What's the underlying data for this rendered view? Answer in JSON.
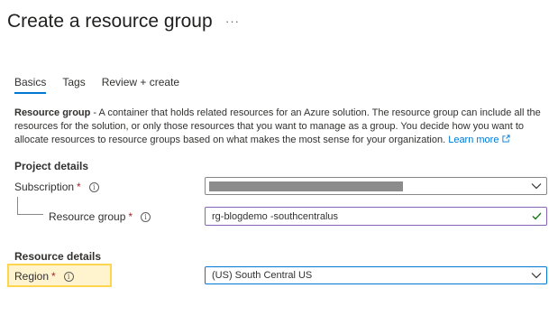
{
  "header": {
    "title": "Create a resource group",
    "more_label": "···"
  },
  "tabs": [
    {
      "label": "Basics",
      "active": true
    },
    {
      "label": "Tags",
      "active": false
    },
    {
      "label": "Review + create",
      "active": false
    }
  ],
  "description": {
    "bold": "Resource group",
    "text": " - A container that holds related resources for an Azure solution. The resource group can include all the resources for the solution, or only those resources that you want to manage as a group. You decide how you want to allocate resources to resource groups based on what makes the most sense for your organization. ",
    "link": "Learn more"
  },
  "project_details": {
    "heading": "Project details",
    "subscription": {
      "label": "Subscription",
      "required": "*",
      "value": ""
    },
    "resource_group": {
      "label": "Resource group",
      "required": "*",
      "value": "rg-blogdemo  -southcentralus"
    }
  },
  "resource_details": {
    "heading": "Resource details",
    "region": {
      "label": "Region",
      "required": "*",
      "value": "(US) South Central US"
    }
  },
  "colors": {
    "accent": "#0078d4",
    "required": "#a4262c",
    "valid": "#107c10",
    "focus_border": "#8764b8",
    "highlight_fill": "#fff4ce",
    "highlight_border": "#ffd54f"
  }
}
